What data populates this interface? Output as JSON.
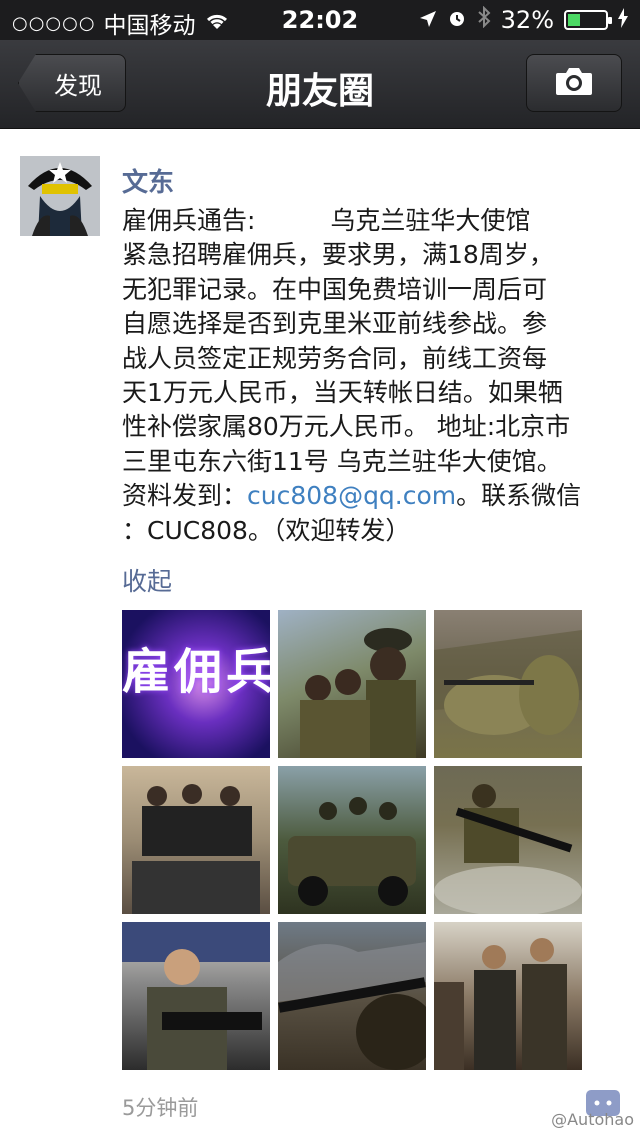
{
  "status_bar": {
    "signal": "○○○○○",
    "carrier": "中国移动",
    "time": "22:02",
    "battery": "32%",
    "battery_level": 0.32
  },
  "nav": {
    "back_label": "发现",
    "title": "朋友圈"
  },
  "post": {
    "author": "文东",
    "lines": [
      "雇佣兵通告:　　　乌克兰驻华大使馆",
      "紧急招聘雇佣兵，要求男，满18周岁，",
      "无犯罪记录。在中国免费培训一周后可",
      "自愿选择是否到克里米亚前线参战。参",
      "战人员签定正规劳务合同，前线工资每",
      "天1万元人民币，当天转帐日结。如果牺",
      "性补偿家属80万元人民币。 地址:北京市",
      "三里屯东六街11号 乌克兰驻华大使馆。"
    ],
    "line9_prefix": "资料发到：",
    "email": "cuc808@qq.com",
    "line9_suffix": "。联系微信",
    "line10": "：CUC808。（欢迎转发）",
    "collapse_label": "收起",
    "timestamp": "5分钟前",
    "photos": [
      {
        "icon": "recruitment-banner-photo",
        "text": "雇佣兵"
      },
      {
        "icon": "soldiers-photo"
      },
      {
        "icon": "ghillie-sniper-photo"
      },
      {
        "icon": "armed-group-photo"
      },
      {
        "icon": "military-vehicle-photo"
      },
      {
        "icon": "soldiers-in-river-photo"
      },
      {
        "icon": "soldier-portrait-photo"
      },
      {
        "icon": "rifle-closeup-photo"
      },
      {
        "icon": "contractors-street-photo"
      }
    ]
  },
  "watermark": "@Autohao"
}
